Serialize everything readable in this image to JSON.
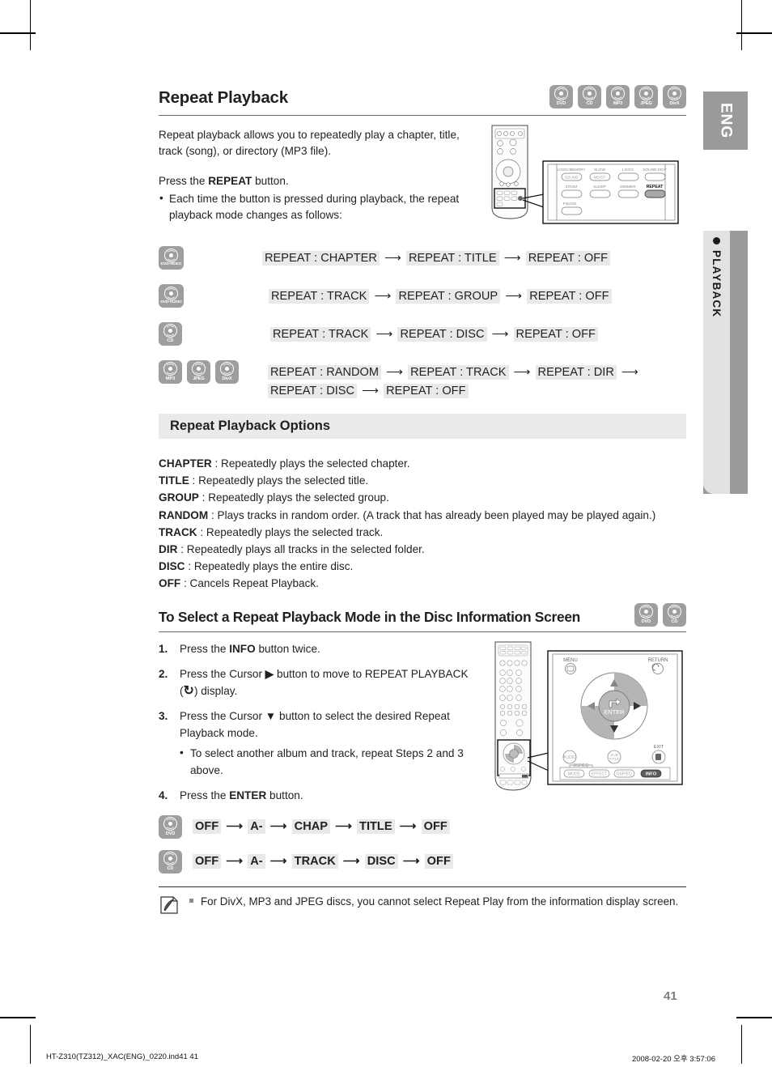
{
  "sidebar": {
    "language_tab": "ENG",
    "section_tab": "PLAYBACK"
  },
  "header": {
    "title": "Repeat Playback",
    "disc_chips": [
      {
        "name": "DVD",
        "label": "DVD"
      },
      {
        "name": "CD",
        "label": "CD"
      },
      {
        "name": "MP3",
        "label": "MP3"
      },
      {
        "name": "JPEG",
        "label": "JPEG"
      },
      {
        "name": "DivX",
        "label": "DivX"
      }
    ]
  },
  "intro": {
    "paragraph1": "Repeat playback allows you to repeatedly play a chapter, title, track (song), or directory (MP3 file).",
    "paragraph2_prefix": "Press the ",
    "paragraph2_bold": "REPEAT",
    "paragraph2_suffix": " button.",
    "bullet1": "Each time the button is pressed during playback, the repeat playback mode changes as follows:"
  },
  "remote_top": {
    "callout_buttons": [
      {
        "label": "SOUND",
        "top_label": "LOGIC/MEMORY",
        "highlighted": false
      },
      {
        "label": "MO/ST",
        "top_label": "SLOW",
        "highlighted": false
      },
      {
        "label": "",
        "top_label": "LOGO",
        "highlighted": false
      },
      {
        "label": "",
        "top_label": "SOUND EDIT",
        "highlighted": false
      },
      {
        "label": "",
        "top_label": "ZOOM",
        "highlighted": false
      },
      {
        "label": "",
        "top_label": "SLEEP",
        "highlighted": false
      },
      {
        "label": "",
        "top_label": "DIMMER",
        "highlighted": false
      },
      {
        "label": "",
        "top_label": "REPEAT",
        "highlighted": true
      },
      {
        "label": "",
        "top_label": "P.BASS",
        "highlighted": false
      }
    ]
  },
  "sequences": [
    {
      "chips": [
        {
          "name": "DVD-VIDEO",
          "label": "DVD-VIDEO"
        }
      ],
      "items": [
        "REPEAT : CHAPTER",
        "REPEAT : TITLE",
        "REPEAT : OFF"
      ]
    },
    {
      "chips": [
        {
          "name": "DVD-AUDIO",
          "label": "DVD-AUDIO"
        }
      ],
      "items": [
        "REPEAT : TRACK",
        "REPEAT : GROUP",
        "REPEAT : OFF"
      ]
    },
    {
      "chips": [
        {
          "name": "CD",
          "label": "CD"
        }
      ],
      "items": [
        "REPEAT : TRACK",
        "REPEAT : DISC",
        "REPEAT : OFF"
      ]
    },
    {
      "chips": [
        {
          "name": "MP3",
          "label": "MP3"
        },
        {
          "name": "JPEG",
          "label": "JPEG"
        },
        {
          "name": "DivX",
          "label": "DivX"
        }
      ],
      "items": [
        "REPEAT : RANDOM",
        "REPEAT : TRACK",
        "REPEAT : DIR",
        "REPEAT : DISC",
        "REPEAT : OFF"
      ]
    }
  ],
  "options_section": {
    "heading": "Repeat Playback Options",
    "items": [
      {
        "term": "CHAPTER",
        "desc": " : Repeatedly plays the selected chapter."
      },
      {
        "term": "TITLE",
        "desc": " : Repeatedly plays the selected title."
      },
      {
        "term": "GROUP",
        "desc": " : Repeatedly plays the selected group."
      },
      {
        "term": "RANDOM",
        "desc": " : Plays tracks in random order. (A track that has already been played may be played again.)"
      },
      {
        "term": "TRACK",
        "desc": " : Repeatedly plays the selected track."
      },
      {
        "term": "DIR",
        "desc": " : Repeatedly plays all tracks in the selected folder."
      },
      {
        "term": "DISC",
        "desc": " : Repeatedly plays the entire disc."
      },
      {
        "term": "OFF",
        "desc": " : Cancels Repeat Playback."
      }
    ]
  },
  "disc_info_section": {
    "heading": "To Select a Repeat Playback Mode in the Disc Information Screen",
    "disc_chips": [
      {
        "name": "DVD",
        "label": "DVD"
      },
      {
        "name": "CD",
        "label": "CD"
      }
    ],
    "steps": [
      {
        "num": "1.",
        "parts": [
          {
            "t": "Press the ",
            "b": false
          },
          {
            "t": "INFO",
            "b": true
          },
          {
            "t": " button twice.",
            "b": false
          }
        ]
      },
      {
        "num": "2.",
        "parts": [
          {
            "t": "Press the Cursor ",
            "b": false
          },
          {
            "t": "▶",
            "b": true
          },
          {
            "t": " button to move to REPEAT PLAYBACK (",
            "b": false
          },
          {
            "t": "↻",
            "b": true
          },
          {
            "t": ") display.",
            "b": false
          }
        ]
      },
      {
        "num": "3.",
        "parts": [
          {
            "t": "Press the Cursor ",
            "b": false
          },
          {
            "t": "▼",
            "b": true
          },
          {
            "t": " button to select the desired Repeat Playback mode.",
            "b": false
          }
        ],
        "substep": "To select another album and track, repeat Steps 2 and 3 above."
      },
      {
        "num": "4.",
        "parts": [
          {
            "t": "Press the ",
            "b": false
          },
          {
            "t": "ENTER",
            "b": true
          },
          {
            "t": " button.",
            "b": false
          }
        ]
      }
    ]
  },
  "remote_bottom": {
    "menu_label": "MENU",
    "return_label": "RETURN",
    "enter_label": "ENTER",
    "exit_label": "EXIT",
    "audio_label": "AUDIO",
    "subtitle_label": "SUB TITLE",
    "dsp_group_label": "DSP/EQ",
    "bottom_buttons": [
      "MODE",
      "EFFECT",
      "DSP/EQ",
      "INFO"
    ],
    "highlighted_button": "INFO"
  },
  "bottom_sequences": [
    {
      "chips": [
        {
          "name": "DVD",
          "label": "DVD"
        }
      ],
      "items": [
        "OFF",
        "A-",
        "CHAP",
        "TITLE",
        "OFF"
      ]
    },
    {
      "chips": [
        {
          "name": "CD",
          "label": "CD"
        }
      ],
      "items": [
        "OFF",
        "A-",
        "TRACK",
        "DISC",
        "OFF"
      ]
    }
  ],
  "note": {
    "text": "For DivX, MP3 and JPEG discs, you cannot select Repeat Play from the information display screen."
  },
  "page_number": "41",
  "footer": {
    "left": "HT-Z310(TZ312)_XAC(ENG)_0220.ind41   41",
    "right": "2008-02-20   오후 3:57:06"
  },
  "colors": {
    "chip_gray": "#9e9e9e",
    "tab_gray": "#9a9a9a",
    "bar_gray": "#eaeaea",
    "highlight_gray": "#e9e9e9"
  }
}
